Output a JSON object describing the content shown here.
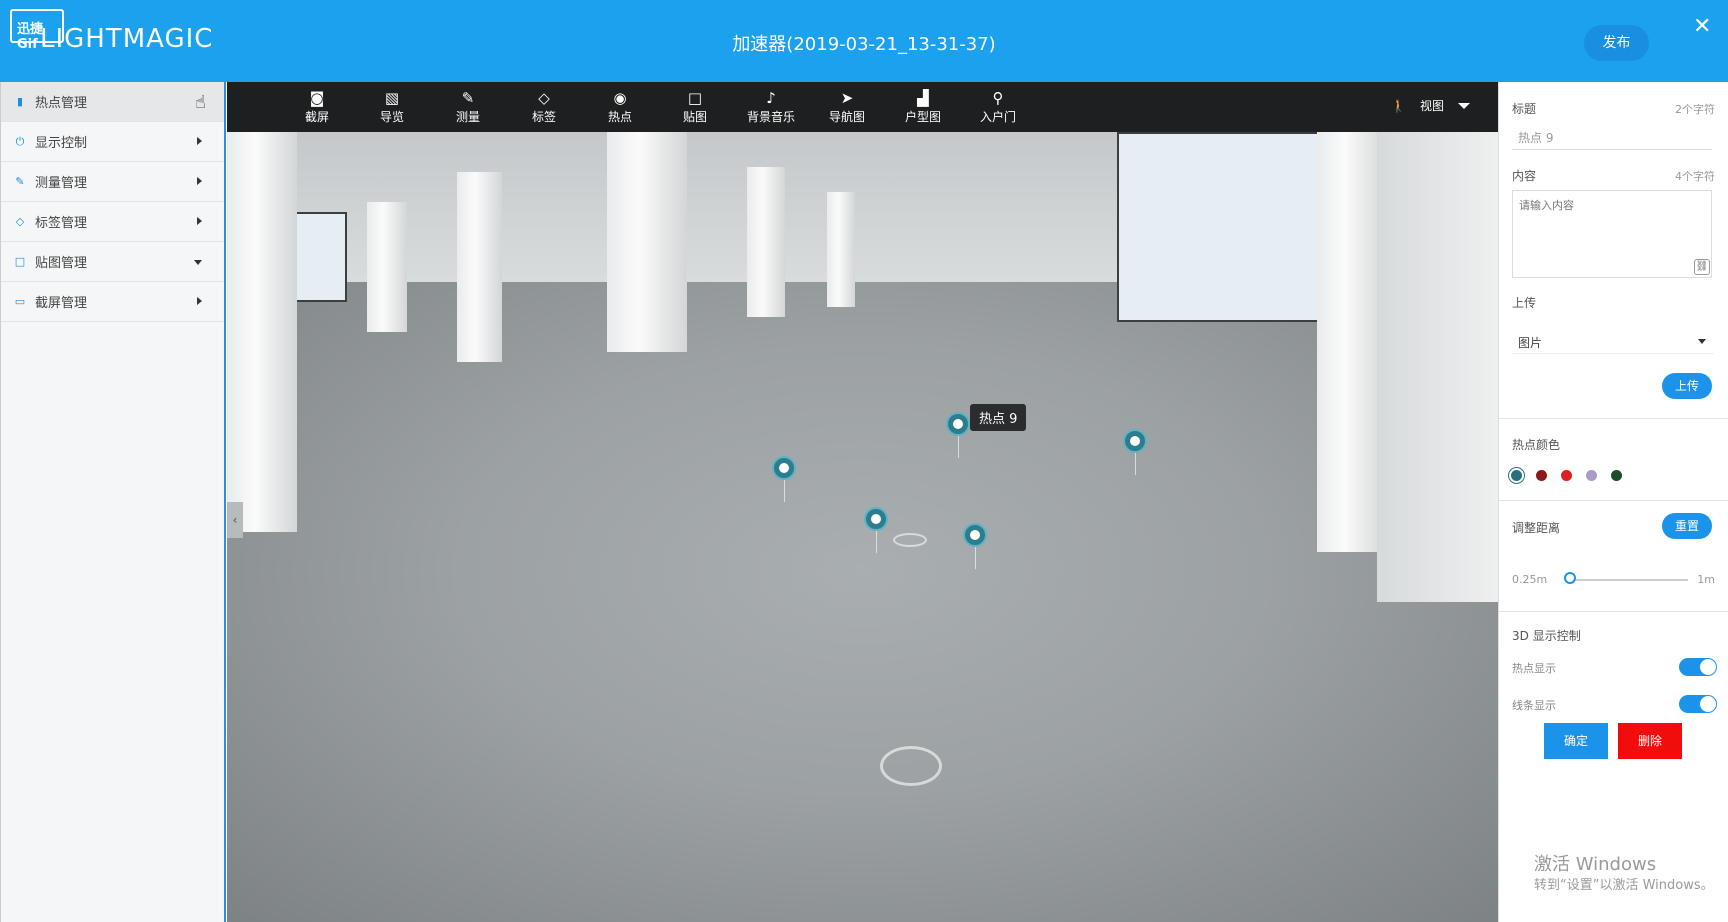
{
  "header": {
    "logo_badge": "迅捷Gif",
    "logo_text": "LIGHTMAGIC",
    "title": "加速器(2019-03-21_13-31-37)",
    "publish_label": "发布",
    "close_icon": "close-icon"
  },
  "sidebar": {
    "items": [
      {
        "label": "热点管理",
        "icon": "bar-chart-icon"
      },
      {
        "label": "显示控制",
        "icon": "power-icon"
      },
      {
        "label": "测量管理",
        "icon": "ruler-icon"
      },
      {
        "label": "标签管理",
        "icon": "tag-icon"
      },
      {
        "label": "贴图管理",
        "icon": "square-icon"
      },
      {
        "label": "截屏管理",
        "icon": "screen-icon"
      }
    ]
  },
  "toolbar": {
    "tools": [
      {
        "label": "截屏",
        "icon": "camera-icon"
      },
      {
        "label": "导览",
        "icon": "image-icon"
      },
      {
        "label": "测量",
        "icon": "pencil-icon"
      },
      {
        "label": "标签",
        "icon": "tag-icon"
      },
      {
        "label": "热点",
        "icon": "target-icon"
      },
      {
        "label": "贴图",
        "icon": "square-icon"
      },
      {
        "label": "背景音乐",
        "icon": "music-icon"
      },
      {
        "label": "导航图",
        "icon": "navigation-icon"
      },
      {
        "label": "户型图",
        "icon": "floorplan-icon"
      },
      {
        "label": "入户门",
        "icon": "location-pin-icon"
      }
    ],
    "view_label": "视图"
  },
  "scene": {
    "tooltip": "热点 9"
  },
  "panel": {
    "title_label": "标题",
    "title_hint": "2个字符",
    "title_value": "热点 9",
    "content_label": "内容",
    "content_hint": "4个字符",
    "content_placeholder": "请输入内容",
    "upload_label": "上传",
    "select_value": "图片",
    "upload_button": "上传",
    "color_label": "热点颜色",
    "colors": [
      "#2a6f7d",
      "#8b1a1a",
      "#e02020",
      "#a99bc4",
      "#1e4d2b"
    ],
    "distance_label": "调整距离",
    "reset_button": "重置",
    "slider_min": "0.25m",
    "slider_max": "1m",
    "display_section": "3D 显示控制",
    "hotspot_display": "热点显示",
    "line_display": "线条显示",
    "confirm_button": "确定",
    "delete_button": "删除",
    "watermark_title": "激活 Windows",
    "watermark_sub": "转到“设置”以激活 Windows。"
  }
}
